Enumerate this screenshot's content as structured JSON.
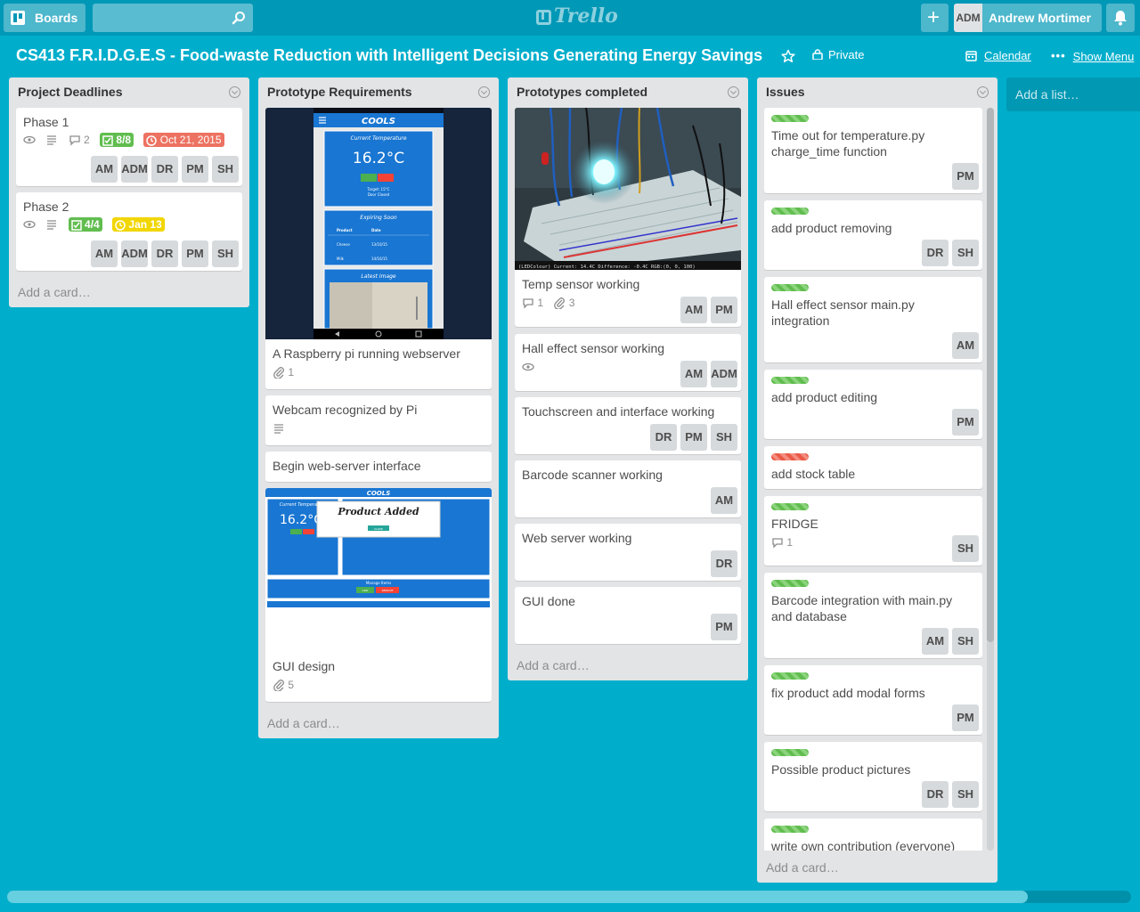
{
  "header": {
    "boards_label": "Boards",
    "search_placeholder": "",
    "logo_text": "Trello",
    "add_label": "+",
    "user_initials": "ADM",
    "user_name": "Andrew Mortimer"
  },
  "board": {
    "title": "CS413 F.R.I.D.G.E.S - Food-waste Reduction with Intelligent Decisions Generating Energy Savings",
    "visibility": "Private",
    "calendar_label": "Calendar",
    "show_menu_label": "Show Menu",
    "add_list_label": "Add a list…"
  },
  "colors": {
    "background": "#00aecc",
    "header": "#0098b7",
    "label_green": "#61bd4f",
    "label_red": "#eb5a46",
    "due_yellow": "#f2d600"
  },
  "lists": [
    {
      "title": "Project Deadlines",
      "add_card": "Add a card…",
      "cards": [
        {
          "title": "Phase 1",
          "comments": "2",
          "checklist": "8/8",
          "due": "Oct 21, 2015",
          "members": [
            "AM",
            "ADM",
            "DR",
            "PM",
            "SH"
          ]
        },
        {
          "title": "Phase 2",
          "checklist": "4/4",
          "due": "Jan 13",
          "members": [
            "AM",
            "ADM",
            "DR",
            "PM",
            "SH"
          ]
        }
      ]
    },
    {
      "title": "Prototype Requirements",
      "add_card": "Add a card…",
      "cards": [
        {
          "title": "A Raspberry pi running webserver",
          "attachments": "1",
          "cover": {
            "app_name": "COOLS",
            "temp_heading": "Current Temperature",
            "temp": "16.2°C",
            "target": "Target: 15°C",
            "door": "Door Closed",
            "expiring_heading": "Expiring Soon",
            "col_product": "Product",
            "col_date": "Date",
            "rows": [
              {
                "product": "Cheese",
                "date": "13/10/15"
              },
              {
                "product": "Milk",
                "date": "14/10/15"
              }
            ],
            "image_heading": "Latest Image"
          }
        },
        {
          "title": "Webcam recognized by Pi"
        },
        {
          "title": "Begin web-server interface"
        },
        {
          "title": "GUI design",
          "attachments": "5",
          "cover": {
            "app_name": "COOLS",
            "temp_heading": "Current Temperature",
            "temp": "16.2°C",
            "modal_title": "Product Added",
            "modal_button": "CLOSE",
            "manage_heading": "Manage Items",
            "add_button": "ADD",
            "remove_button": "REMOVE"
          }
        }
      ]
    },
    {
      "title": "Prototypes completed",
      "add_card": "Add a card…",
      "cards": [
        {
          "title": "Temp sensor working",
          "comments": "1",
          "attachments": "3",
          "members": [
            "AM",
            "PM"
          ],
          "cover": {
            "caption": "(LEDColour) Current: 14.4C   Difference: -0.4C   RGB:(0, 0, 100)"
          }
        },
        {
          "title": "Hall effect sensor working",
          "members": [
            "AM",
            "ADM"
          ]
        },
        {
          "title": "Touchscreen and interface working",
          "members": [
            "DR",
            "PM",
            "SH"
          ]
        },
        {
          "title": "Barcode scanner working",
          "members": [
            "AM"
          ]
        },
        {
          "title": "Web server working",
          "members": [
            "DR"
          ]
        },
        {
          "title": "GUI done",
          "members": [
            "PM"
          ]
        }
      ]
    },
    {
      "title": "Issues",
      "add_card": "Add a card…",
      "cards": [
        {
          "label": "green",
          "title_line1": "Time out for temperature.py",
          "title_line2": "charge_time function",
          "members": [
            "PM"
          ]
        },
        {
          "label": "green",
          "title": "add product removing",
          "members": [
            "DR",
            "SH"
          ]
        },
        {
          "label": "green",
          "title_line1": "Hall effect sensor main.py",
          "title_line2": "integration",
          "members": [
            "AM"
          ]
        },
        {
          "label": "green",
          "title": "add product editing",
          "members": [
            "PM"
          ]
        },
        {
          "label": "red",
          "title": "add stock table"
        },
        {
          "label": "green",
          "title": "FRIDGE",
          "comments": "1",
          "members": [
            "SH"
          ]
        },
        {
          "label": "green",
          "title_line1": "Barcode integration with main.py",
          "title_line2": "and database",
          "members": [
            "AM",
            "SH"
          ]
        },
        {
          "label": "green",
          "title": "fix product add modal forms",
          "members": [
            "PM"
          ]
        },
        {
          "label": "green",
          "title": "Possible product pictures",
          "members": [
            "DR",
            "SH"
          ]
        },
        {
          "label": "green",
          "title": "write own contribution (everyone)"
        }
      ]
    }
  ]
}
